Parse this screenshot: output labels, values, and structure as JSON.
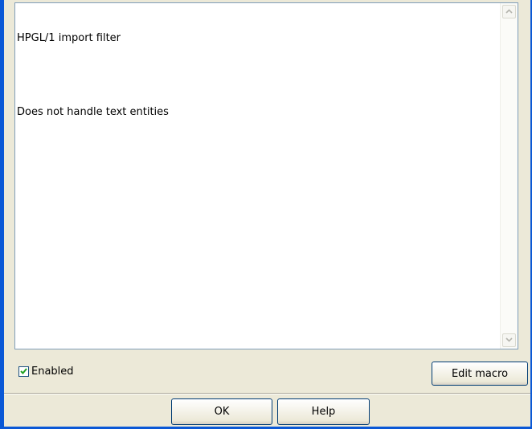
{
  "description": {
    "lines": [
      "HPGL/1 import filter",
      "Does not handle text entities"
    ]
  },
  "enabled": {
    "label": "Enabled",
    "checked": true
  },
  "buttons": {
    "edit_macro": "Edit macro",
    "ok": "OK",
    "help": "Help"
  },
  "colors": {
    "window_border": "#0a58d6",
    "dialog_bg": "#ece9d8",
    "checkmark": "#21a121"
  }
}
